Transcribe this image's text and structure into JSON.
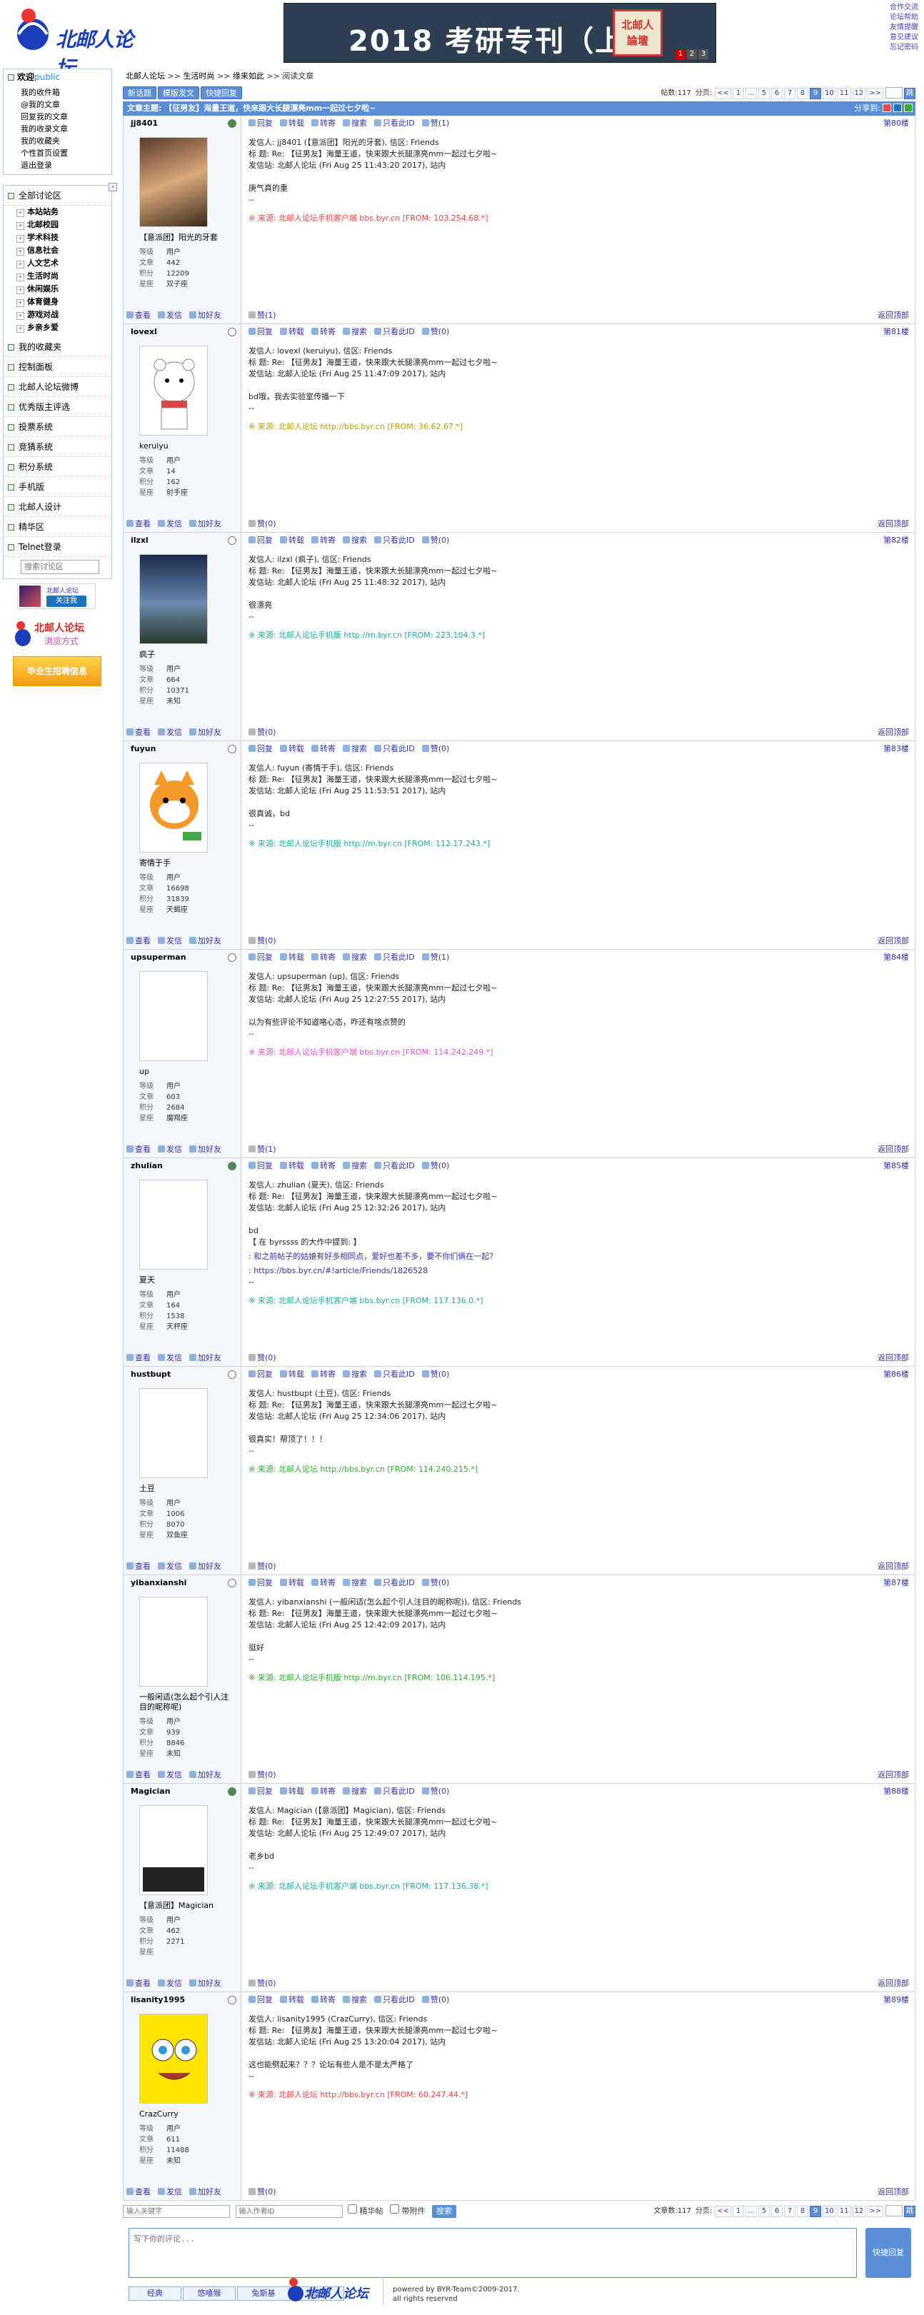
{
  "site": {
    "logo_text": "北邮人论坛",
    "banner_title": "2018 考研专刊（上）",
    "banner_stamp": "北邮人\n論壇",
    "banner_pages": [
      "1",
      "2",
      "3"
    ]
  },
  "toplinks": [
    "合作交流",
    "论坛帮助",
    "友情提醒",
    "意见建议",
    "忘记密码"
  ],
  "sidebar": {
    "welcome": "欢迎",
    "user": "public",
    "user_links": [
      "我的收件箱",
      "@我的文章",
      "回复我的文章",
      "我的收录文章",
      "我的收藏夹",
      "个性首页设置",
      "退出登录"
    ],
    "all_sections": "全部讨论区",
    "sections": [
      "本站站务",
      "北邮校园",
      "学术科技",
      "信息社会",
      "人文艺术",
      "生活时尚",
      "休闲娱乐",
      "体育健身",
      "游戏对战",
      "乡亲乡爱"
    ],
    "items": [
      "我的收藏夹",
      "控制面板",
      "北邮人论坛微博",
      "优秀版主评选",
      "投票系统",
      "竞猜系统",
      "积分系统",
      "手机版",
      "北邮人设计",
      "精华区",
      "Telnet登录"
    ],
    "search_placeholder": "搜索讨论区",
    "weibo_name": "北邮人论坛",
    "weibo_follow": "关注我",
    "ad1_line1": "北邮人论坛",
    "ad1_line2": "浏览方式",
    "ad2": "毕业生招聘信息"
  },
  "crumb": [
    "北邮人论坛",
    ">>",
    "生活时尚",
    ">>",
    "缘来如此",
    ">>",
    "阅读文章"
  ],
  "buttons": {
    "new": "新话题",
    "template": "模版发文",
    "quick": "快捷回复"
  },
  "pager": {
    "count_label": "帖数:117",
    "page_label": "分页:",
    "pages": [
      "<<",
      "1",
      "...",
      "5",
      "6",
      "7",
      "8",
      "9",
      "10",
      "11",
      "12",
      ">>"
    ],
    "current": "9"
  },
  "pager_bottom": {
    "count_label": "文章数:117"
  },
  "topic": {
    "title": "文章主题: 【征男友】海量王道，快来跟大长腿漂亮mm一起过七夕啦~",
    "share": "分享到:"
  },
  "toolbar": [
    "回复",
    "转载",
    "转寄",
    "搜索",
    "只看此ID"
  ],
  "user_fields": [
    "等级",
    "文章",
    "积分",
    "星座"
  ],
  "actions": [
    "查看",
    "发信",
    "加好友"
  ],
  "to_top": "返回顶部",
  "posts": [
    {
      "user": "jj8401",
      "online": true,
      "nick": "【意派团】阳光的牙套",
      "level": "用户",
      "articles": "442",
      "score": "12209",
      "star": "双子座",
      "zan_top": "赞(1)",
      "zan_bot": "赞(1)",
      "floor": "第80楼",
      "sender": "发信人: jj8401 (【意派团】阳光的牙套), 信区: Friends",
      "subj": "标  题: Re: 【征男友】海量王道，快来跟大长腿漂亮mm一起过七夕啦~",
      "site": "发信站: 北邮人论坛 (Fri Aug 25 11:43:20 2017), 站内",
      "body": [
        "庚气真的重",
        "--"
      ],
      "src": "※ 来源: 北邮人论坛手机客户端 bbs.byr.cn [FROM: 103.254.68.*]",
      "color": "#e44"
    },
    {
      "user": "lovexl",
      "online": false,
      "nick": "keruiyu",
      "level": "用户",
      "articles": "14",
      "score": "162",
      "star": "射手座",
      "zan_top": "赞(0)",
      "zan_bot": "赞(0)",
      "floor": "第81楼",
      "sender": "发信人: lovexl (keruiyu), 信区: Friends",
      "subj": "标  题: Re: 【征男友】海量王道，快来跟大长腿漂亮mm一起过七夕啦~",
      "site": "发信站: 北邮人论坛 (Fri Aug 25 11:47:09 2017), 站内",
      "body": [
        "bd哦，我去实验室传播一下",
        "--"
      ],
      "src": "※ 来源: 北邮人论坛 http://bbs.byr.cn [FROM: 36.62.67.*]",
      "color": "#b8a000"
    },
    {
      "user": "ilzxl",
      "online": false,
      "nick": "疯子",
      "level": "用户",
      "articles": "664",
      "score": "10371",
      "star": "未知",
      "zan_top": "赞(0)",
      "zan_bot": "赞(0)",
      "floor": "第82楼",
      "sender": "发信人: ilzxl (疯子), 信区: Friends",
      "subj": "标  题: Re: 【征男友】海量王道，快来跟大长腿漂亮mm一起过七夕啦~",
      "site": "发信站: 北邮人论坛 (Fri Aug 25 11:48:32 2017), 站内",
      "body": [
        "很漂亮",
        "--"
      ],
      "src": "※ 来源: 北邮人论坛手机版 http://m.byr.cn [FROM: 223.104.3.*]",
      "color": "#2a9"
    },
    {
      "user": "fuyun",
      "online": false,
      "nick": "寄情于手",
      "level": "用户",
      "articles": "16698",
      "score": "31839",
      "star": "天蝎座",
      "zan_top": "赞(0)",
      "zan_bot": "赞(0)",
      "floor": "第83楼",
      "sender": "发信人: fuyun (寄情于手), 信区: Friends",
      "subj": "标  题: Re: 【征男友】海量王道，快来跟大长腿漂亮mm一起过七夕啦~",
      "site": "发信站: 北邮人论坛 (Fri Aug 25 11:53:51 2017), 站内",
      "body": [
        "很真诚，bd",
        "--"
      ],
      "src": "※ 来源: 北邮人论坛手机版 http://m.byr.cn [FROM: 112.17.243.*]",
      "color": "#2a9"
    },
    {
      "user": "upsuperman",
      "online": false,
      "nick": "up",
      "level": "用户",
      "articles": "603",
      "score": "2684",
      "star": "魔羯座",
      "zan_top": "赞(1)",
      "zan_bot": "赞(1)",
      "floor": "第84楼",
      "sender": "发信人: upsuperman (up), 信区: Friends",
      "subj": "标  题: Re: 【征男友】海量王道，快来跟大长腿漂亮mm一起过七夕啦~",
      "site": "发信站: 北邮人论坛 (Fri Aug 25 12:27:55 2017), 站内",
      "body": [
        "以为有些评论不知道咯心态，咋还有啥点赞的",
        "--"
      ],
      "src": "※ 来源: 北邮人论坛手机客户端 bbs.byr.cn [FROM: 114.242.249.*]",
      "color": "#d5c"
    },
    {
      "user": "zhulian",
      "online": true,
      "nick": "夏天",
      "level": "用户",
      "articles": "164",
      "score": "1538",
      "star": "天秤座",
      "zan_top": "赞(0)",
      "zan_bot": "赞(0)",
      "floor": "第85楼",
      "sender": "发信人: zhulian (夏天), 信区: Friends",
      "subj": "标  题: Re: 【征男友】海量王道，快来跟大长腿漂亮mm一起过七夕啦~",
      "site": "发信站: 北邮人论坛 (Fri Aug 25 12:32:26 2017), 站内",
      "body": [
        "bd",
        "【 在 byrssss 的大作中提到: 】",
        ": 和之前帖子的姑娘有好多相同点，爱好也差不多，要不你们俩在一起？",
        ": https://bbs.byr.cn/#!article/Friends/1826528",
        "--"
      ],
      "src": "※ 来源: 北邮人论坛手机客户端 bbs.byr.cn [FROM: 117.136.0.*]",
      "color": "#2a9"
    },
    {
      "user": "hustbupt",
      "online": false,
      "nick": "土豆",
      "level": "用户",
      "articles": "1006",
      "score": "8070",
      "star": "双鱼座",
      "zan_top": "赞(0)",
      "zan_bot": "赞(0)",
      "floor": "第86楼",
      "sender": "发信人: hustbupt (土豆), 信区: Friends",
      "subj": "标  题: Re: 【征男友】海量王道，快来跟大长腿漂亮mm一起过七夕啦~",
      "site": "发信站: 北邮人论坛 (Fri Aug 25 12:34:06 2017), 站内",
      "body": [
        "很真实！帮顶了！！！",
        "--"
      ],
      "src": "※ 来源: 北邮人论坛 http://bbs.byr.cn [FROM: 114.240.215.*]",
      "color": "#3a3"
    },
    {
      "user": "yibanxianshi",
      "online": false,
      "nick": "一般闲适(怎么起个引人注目的昵称呢)",
      "level": "用户",
      "articles": "939",
      "score": "8846",
      "star": "未知",
      "zan_top": "赞(0)",
      "zan_bot": "赞(0)",
      "floor": "第87楼",
      "sender": "发信人: yibanxianshi (一般闲适(怎么起个引人注目的昵称呢)), 信区: Friends",
      "subj": "标  题: Re: 【征男友】海量王道，快来跟大长腿漂亮mm一起过七夕啦~",
      "site": "发信站: 北邮人论坛 (Fri Aug 25 12:42:09 2017), 站内",
      "body": [
        "挺好",
        "--"
      ],
      "src": "※ 来源: 北邮人论坛手机版 http://m.byr.cn [FROM: 106.114.195.*]",
      "color": "#3a3"
    },
    {
      "user": "Magician",
      "online": true,
      "nick": "【意派团】Magician",
      "level": "用户",
      "articles": "462",
      "score": "2271",
      "star": "",
      "zan_top": "赞(0)",
      "zan_bot": "赞(0)",
      "floor": "第88楼",
      "sender": "发信人: Magician (【意派团】Magician), 信区: Friends",
      "subj": "标  题: Re: 【征男友】海量王道，快来跟大长腿漂亮mm一起过七夕啦~",
      "site": "发信站: 北邮人论坛 (Fri Aug 25 12:49:07 2017), 站内",
      "body": [
        "老乡bd",
        "--"
      ],
      "src": "※ 来源: 北邮人论坛手机客户端 bbs.byr.cn [FROM: 117.136.38.*]",
      "color": "#2a9"
    },
    {
      "user": "lisanity1995",
      "online": false,
      "nick": "CrazCurry",
      "level": "用户",
      "articles": "611",
      "score": "11488",
      "star": "未知",
      "zan_top": "赞(0)",
      "zan_bot": "赞(0)",
      "floor": "第89楼",
      "sender": "发信人: lisanity1995 (CrazCurry), 信区: Friends",
      "subj": "标  题: Re: 【征男友】海量王道，快来跟大长腿漂亮mm一起过七夕啦~",
      "site": "发信站: 北邮人论坛 (Fri Aug 25 13:20:04 2017), 站内",
      "body": [
        "这也能劈起来？？？论坛有些人是不是太严格了",
        "--"
      ],
      "src": "※ 来源: 北邮人论坛 http://bbs.byr.cn [FROM: 60.247.44.*]",
      "color": "#e44"
    }
  ],
  "bottom": {
    "kw_placeholder": "输入关键字",
    "author_placeholder": "输入作者ID",
    "essence": "精华帖",
    "attach": "带附件",
    "search": "搜索"
  },
  "reply": {
    "placeholder": "写下你的评论...",
    "button": "快捷回复",
    "emot_tabs": [
      "经典",
      "悠嘻猴",
      "兔斯基",
      "洋葱头"
    ]
  },
  "footer": {
    "logo_text": "北邮人论坛",
    "line1": "powered by BYR-Team©2009-2017.",
    "line2": "all rights reserved"
  }
}
